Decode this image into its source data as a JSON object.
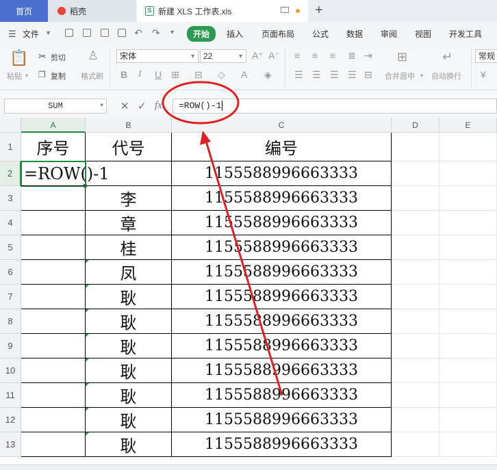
{
  "tabs": {
    "home": "首页",
    "docer": "稻壳",
    "document": "新建 XLS 工作表.xls"
  },
  "menubar": {
    "file": "文件",
    "items": [
      "开始",
      "插入",
      "页面布局",
      "公式",
      "数据",
      "审阅",
      "视图",
      "开发工具"
    ]
  },
  "ribbon": {
    "paste": "粘贴",
    "cut": "剪切",
    "copy": "复制",
    "format_painter": "格式刷",
    "font_name": "宋体",
    "font_size": "22",
    "bold": "B",
    "italic": "I",
    "underline": "U",
    "merge_center": "合并居中",
    "wrap_text": "自动换行",
    "number_format": "常规",
    "currency": "¥"
  },
  "formula_bar": {
    "name_box": "SUM",
    "fx": "fx",
    "formula": "=ROW()-1"
  },
  "grid": {
    "columns": [
      "A",
      "B",
      "C",
      "D",
      "E"
    ],
    "rows": [
      {
        "num": "1",
        "a": "序号",
        "b": "代号",
        "c": "编号"
      },
      {
        "num": "2",
        "a": "=ROW()-1",
        "b": "",
        "c": "1155588996663333"
      },
      {
        "num": "3",
        "a": "",
        "b": "李",
        "c": "1155588996663333"
      },
      {
        "num": "4",
        "a": "",
        "b": "章",
        "c": "1155588996663333"
      },
      {
        "num": "5",
        "a": "",
        "b": "桂",
        "c": "1155588996663333"
      },
      {
        "num": "6",
        "a": "",
        "b": "凤",
        "c": "1155588996663333"
      },
      {
        "num": "7",
        "a": "",
        "b": "耿",
        "c": "1155588996663333"
      },
      {
        "num": "8",
        "a": "",
        "b": "耿",
        "c": "1155588996663333"
      },
      {
        "num": "9",
        "a": "",
        "b": "耿",
        "c": "1155588996663333"
      },
      {
        "num": "10",
        "a": "",
        "b": "耿",
        "c": "1155588996663333"
      },
      {
        "num": "11",
        "a": "",
        "b": "耿",
        "c": "1155588996663333"
      },
      {
        "num": "12",
        "a": "",
        "b": "耿",
        "c": "1155588996663333"
      },
      {
        "num": "13",
        "a": "",
        "b": "耿",
        "c": "1155588996663333"
      }
    ]
  },
  "colors": {
    "accent_green": "#2b9a52",
    "annotation_red": "#e02020",
    "home_tab_blue": "#4a6fd0"
  }
}
